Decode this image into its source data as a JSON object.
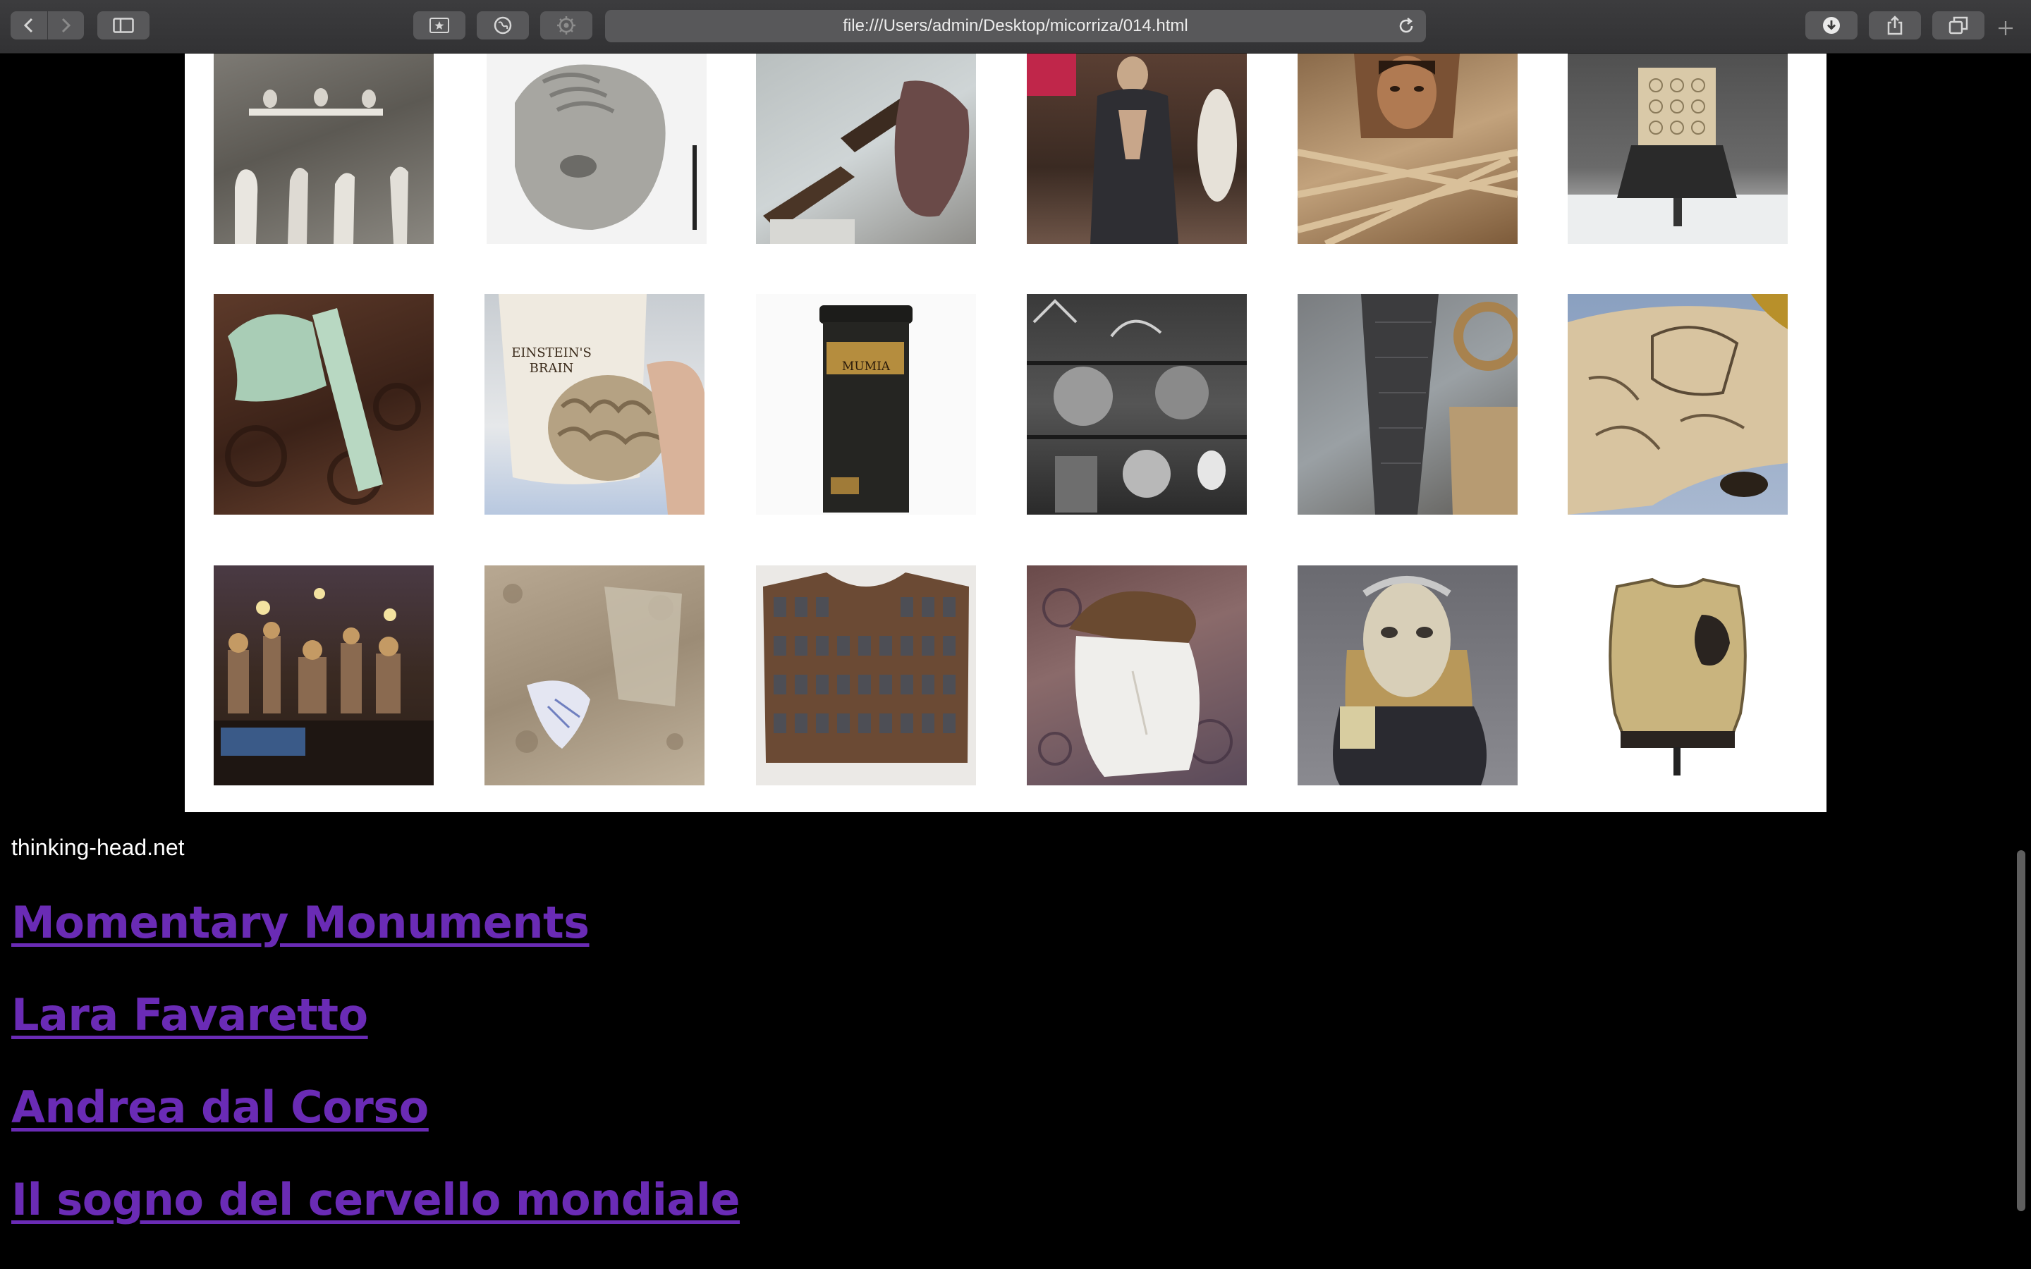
{
  "browser": {
    "url": "file:///Users/admin/Desktop/micorriza/014.html"
  },
  "gallery": {
    "tiles": [
      {
        "label": ""
      },
      {
        "label": ""
      },
      {
        "label": ""
      },
      {
        "label": ""
      },
      {
        "label": ""
      },
      {
        "label": ""
      },
      {
        "label": ""
      },
      {
        "label": "EINSTEIN'S\nBRAIN"
      },
      {
        "label": "MUMIA"
      },
      {
        "label": ""
      },
      {
        "label": ""
      },
      {
        "label": ""
      },
      {
        "label": ""
      },
      {
        "label": ""
      },
      {
        "label": ""
      },
      {
        "label": ""
      },
      {
        "label": ""
      },
      {
        "label": ""
      }
    ]
  },
  "content": {
    "source": "thinking-head.net",
    "links": [
      "Momentary Monuments",
      "Lara Favaretto",
      "Andrea dal Corso",
      "Il sogno del cervello mondiale"
    ]
  },
  "colors": {
    "link": "#6a2bb5",
    "page_background": "#000000",
    "gallery_background": "#ffffff"
  }
}
